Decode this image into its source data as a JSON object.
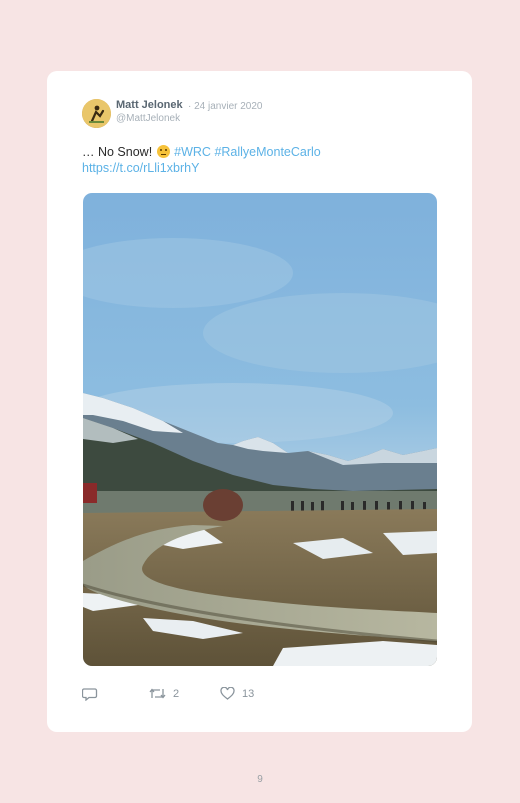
{
  "tweet": {
    "author_name": "Matt Jelonek",
    "date": "· 24 janvier 2020",
    "handle": "@MattJelonek",
    "text_prefix": "… No Snow!",
    "emoji": "neutral-face-emoji",
    "hashtag_1": "#WRC",
    "hashtag_2": "#RallyeMonteCarlo",
    "link": "https://t.co/rLli1xbrhY",
    "image_alt": "mountain-rally-road-photo"
  },
  "actions": {
    "reply_count": "",
    "retweet_count": "2",
    "like_count": "13"
  },
  "page": {
    "number": "9"
  },
  "colors": {
    "background": "#f7e4e4",
    "card": "#ffffff",
    "link": "#5cb2e6",
    "name": "#5a6772",
    "muted": "#a7b0b8"
  }
}
